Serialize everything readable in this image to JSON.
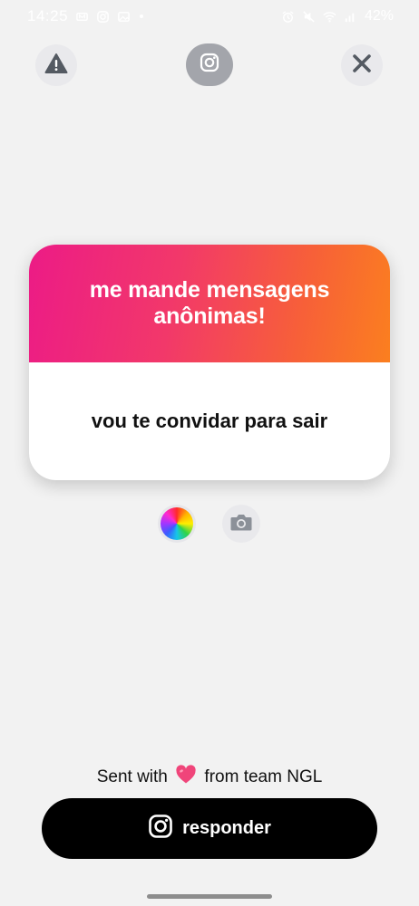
{
  "status_bar": {
    "time": "14:25",
    "left_icons": [
      "alarm-badge-icon",
      "instagram-icon",
      "gallery-icon",
      "dot-icon"
    ],
    "right_icons": [
      "alarm-icon",
      "mute-icon",
      "wifi-icon",
      "signal-icon"
    ],
    "battery": "42%"
  },
  "header": {
    "icons": {
      "report": "warning-icon",
      "share": "instagram-icon",
      "close": "close-icon"
    }
  },
  "card": {
    "title": "me mande mensagens anônimas!",
    "question": "vou te convidar para sair",
    "gradient": [
      "#ec1b86",
      "#fb7f1f"
    ]
  },
  "tools": {
    "icons": {
      "color": "color-wheel-icon",
      "camera": "camera-icon"
    }
  },
  "footer": {
    "sent_prefix": "Sent with",
    "sent_suffix": "from team NGL",
    "heart_color": "#f0457a"
  },
  "reply_button": {
    "label": "responder",
    "icon": "instagram-icon",
    "background": "#000000"
  }
}
